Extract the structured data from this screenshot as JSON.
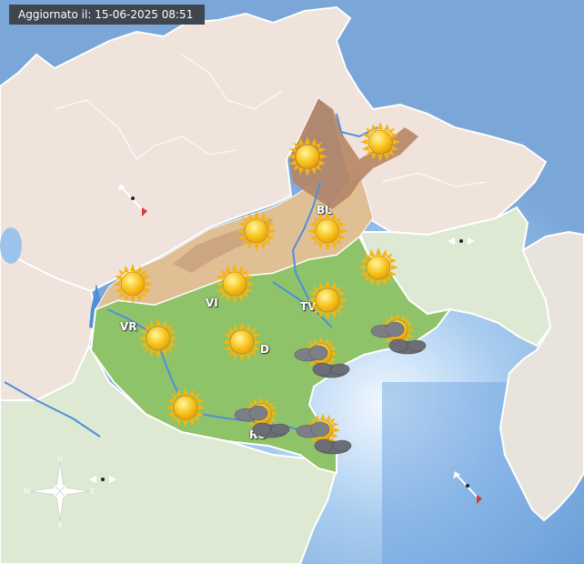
{
  "header": {
    "updated_text": "Aggiornato il: 15-06-2025 08:51"
  },
  "cities": [
    {
      "id": "bl",
      "label": "BL"
    },
    {
      "id": "vi",
      "label": "VI"
    },
    {
      "id": "tv",
      "label": "TV"
    },
    {
      "id": "vr",
      "label": "VR"
    },
    {
      "id": "pd",
      "label": "D"
    },
    {
      "id": "ro",
      "label": "RO"
    }
  ],
  "weather_icons": [
    "sunny-icon",
    "sunny-icon",
    "sunny-icon",
    "sunny-icon",
    "sunny-icon",
    "sunny-icon",
    "sunny-icon",
    "sunny-icon",
    "sunny-icon",
    "sunny-icon",
    "sunny-icon",
    "sun-cloud-icon",
    "sun-cloud-icon",
    "sun-cloud-icon",
    "sun-cloud-icon"
  ],
  "compass": {
    "n": "N",
    "e": "E",
    "s": "S",
    "w": "W"
  },
  "colors": {
    "sea": "#7fa9d6",
    "veneto_plain": "#8fc36a",
    "veneto_hills": "#e0bf95",
    "veneto_mountains": "#b58564",
    "outside_land": "#efe3dc",
    "outside_plain": "#dde9d2",
    "rivers": "#4f8fd8"
  }
}
